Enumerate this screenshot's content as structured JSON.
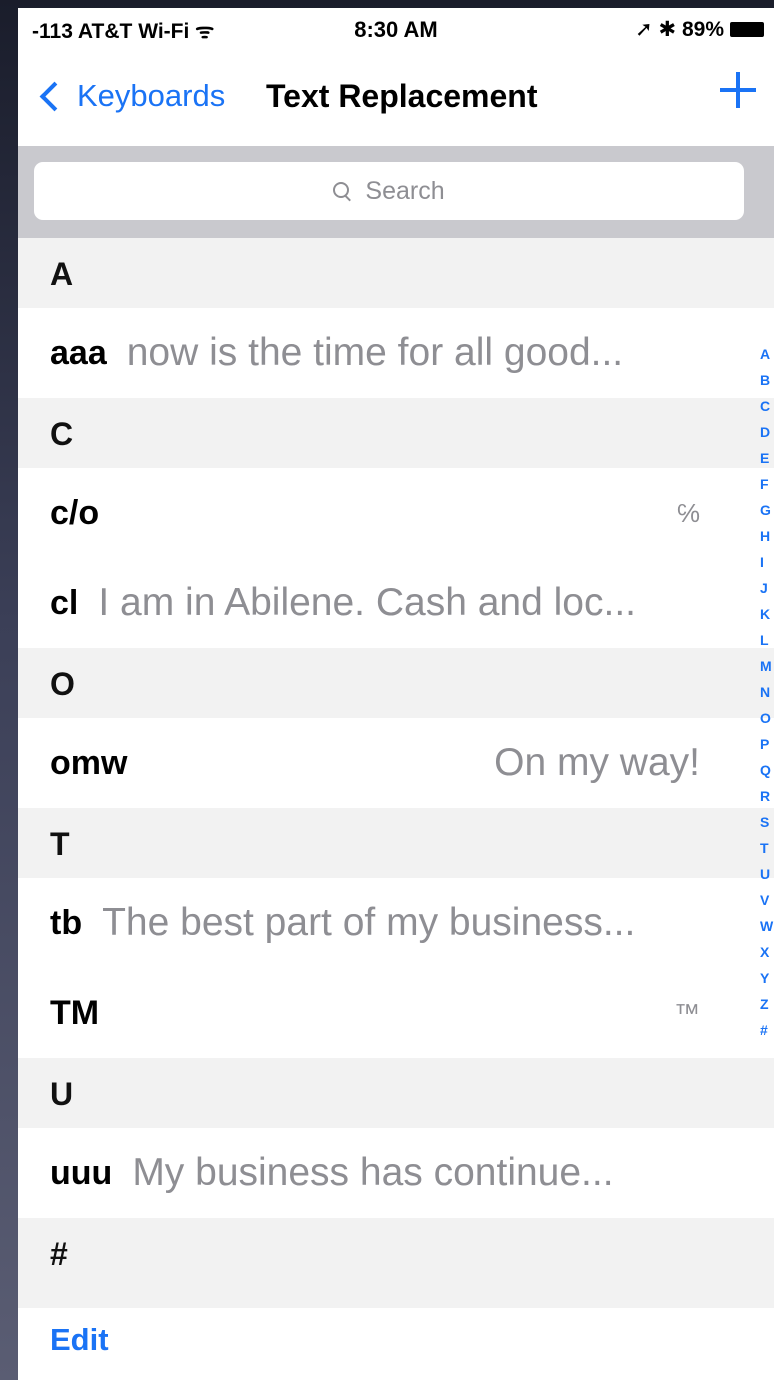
{
  "status_bar": {
    "carrier": "-113 AT&T Wi-Fi ᯤ",
    "time": "8:30 AM",
    "indicators": "➚ ✱ 89%"
  },
  "nav": {
    "back_label": "Keyboards",
    "title": "Text Replacement",
    "add_icon": "plus-icon"
  },
  "search": {
    "placeholder": "Search"
  },
  "sections": [
    {
      "letter": "A",
      "rows": [
        {
          "shortcut": "aaa",
          "phrase": "now is the time for all good..."
        }
      ]
    },
    {
      "letter": "C",
      "rows": [
        {
          "shortcut": "c/o",
          "phrase": "℅"
        },
        {
          "shortcut": "cl",
          "phrase": "I am in Abilene.  Cash and loc..."
        }
      ]
    },
    {
      "letter": "O",
      "rows": [
        {
          "shortcut": "omw",
          "phrase": "On my way!"
        }
      ]
    },
    {
      "letter": "T",
      "rows": [
        {
          "shortcut": "tb",
          "phrase": "The best part of my business..."
        },
        {
          "shortcut": "TM",
          "phrase": "™"
        }
      ]
    },
    {
      "letter": "U",
      "rows": [
        {
          "shortcut": "uuu",
          "phrase": "My business has continue..."
        }
      ]
    },
    {
      "letter": "#",
      "rows": []
    }
  ],
  "index_letters": [
    "A",
    "B",
    "C",
    "D",
    "E",
    "F",
    "G",
    "H",
    "I",
    "J",
    "K",
    "L",
    "M",
    "N",
    "O",
    "P",
    "Q",
    "R",
    "S",
    "T",
    "U",
    "V",
    "W",
    "X",
    "Y",
    "Z",
    "#"
  ],
  "toolbar": {
    "edit_label": "Edit"
  },
  "colors": {
    "accent": "#1a73f5",
    "section_bg": "#f2f2f2",
    "secondary_text": "#8e8e93"
  }
}
